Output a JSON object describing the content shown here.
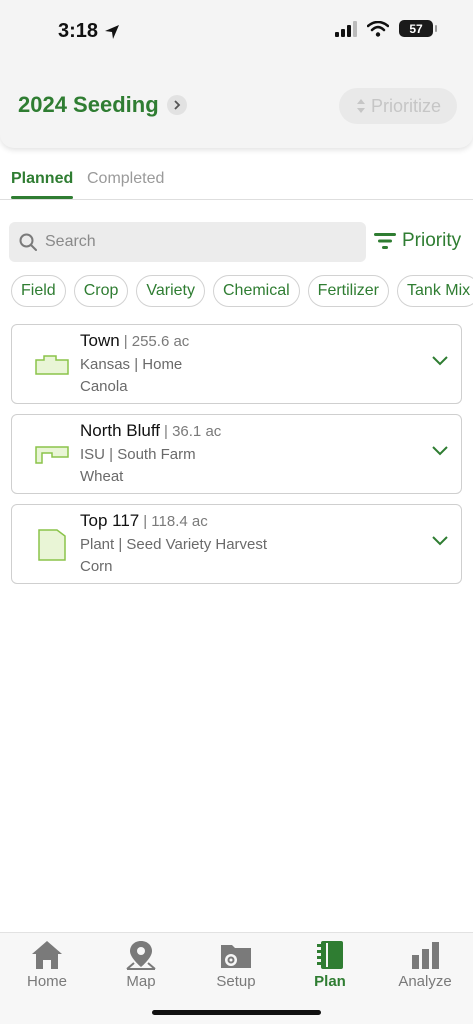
{
  "status_bar": {
    "time": "3:18",
    "battery": "57"
  },
  "header": {
    "title": "2024 Seeding",
    "prioritize_label": "Prioritize"
  },
  "tabs": [
    {
      "label": "Planned",
      "active": true
    },
    {
      "label": "Completed",
      "active": false
    }
  ],
  "search": {
    "placeholder": "Search",
    "value": ""
  },
  "sort": {
    "label": "Priority"
  },
  "filter_chips": [
    "Field",
    "Crop",
    "Variety",
    "Chemical",
    "Fertilizer",
    "Tank Mix"
  ],
  "fields": [
    {
      "name": "Town",
      "acres": "| 255.6 ac",
      "location": "Kansas | Home",
      "crop": "Canola"
    },
    {
      "name": "North Bluff",
      "acres": "| 36.1 ac",
      "location": "ISU | South Farm",
      "crop": "Wheat"
    },
    {
      "name": "Top 117",
      "acres": "| 118.4 ac",
      "location": "Plant | Seed Variety Harvest",
      "crop": "Corn"
    }
  ],
  "bottom_nav": [
    {
      "label": "Home",
      "icon": "home-icon"
    },
    {
      "label": "Map",
      "icon": "map-pin-icon"
    },
    {
      "label": "Setup",
      "icon": "folder-gear-icon"
    },
    {
      "label": "Plan",
      "icon": "notebook-icon",
      "active": true
    },
    {
      "label": "Analyze",
      "icon": "bar-chart-icon"
    }
  ],
  "colors": {
    "accent": "#2f7d32",
    "field_fill": "#e9f5d6",
    "field_stroke": "#8bc34a"
  }
}
